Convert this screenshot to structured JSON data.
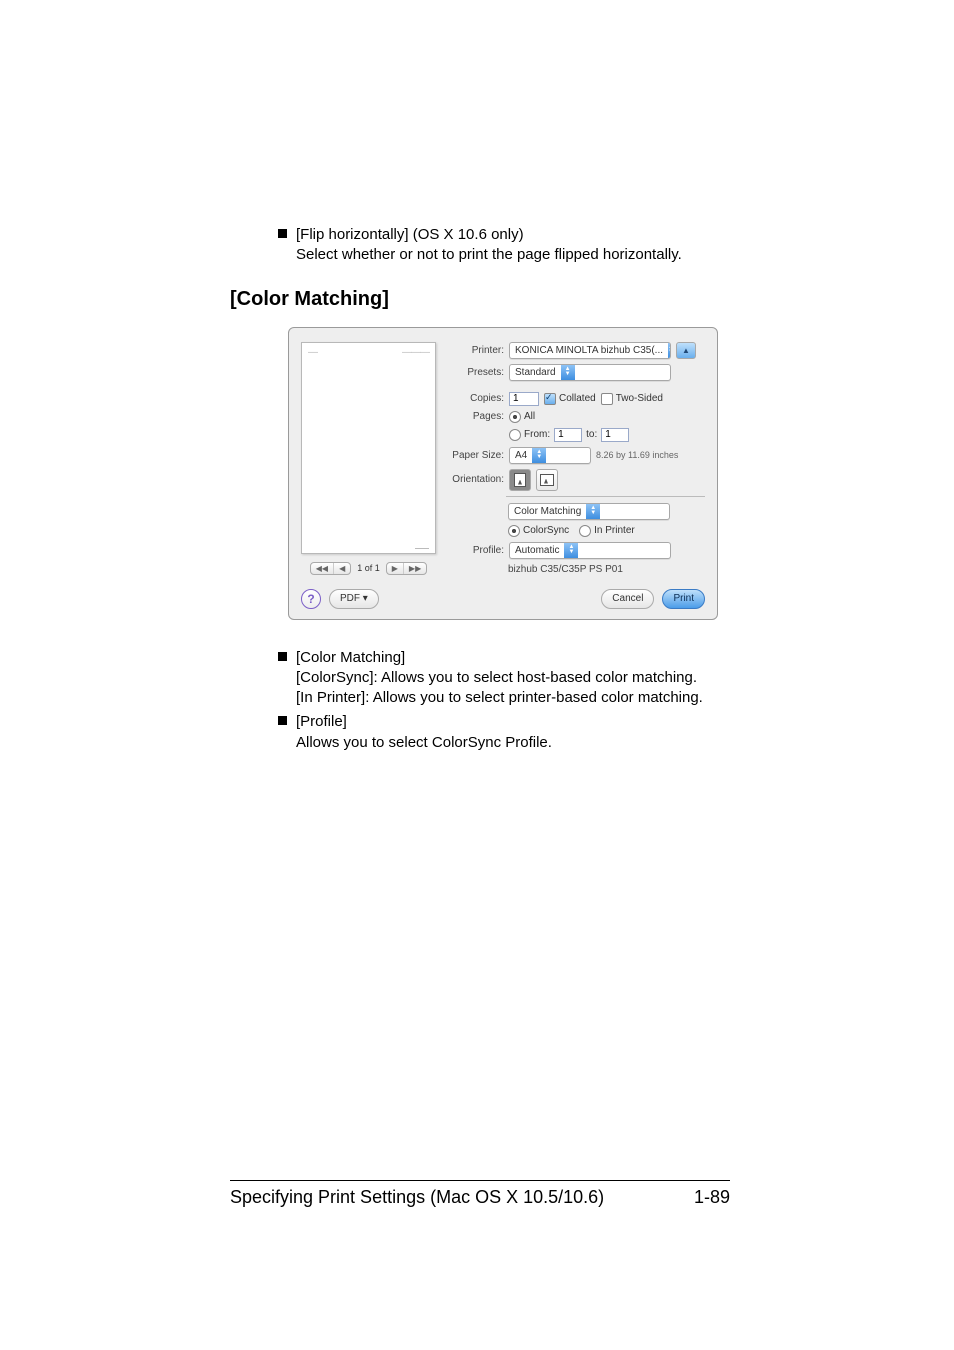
{
  "bullets_top": [
    {
      "head": "[Flip horizontally] (OS X 10.6 only)",
      "desc": "Select whether or not to print the page flipped horizontally."
    }
  ],
  "section_title": "[Color Matching]",
  "dialog": {
    "preview_nav": {
      "page": "1 of 1"
    },
    "rows": {
      "printer_label": "Printer:",
      "printer_value": "KONICA MINOLTA bizhub C35(...",
      "presets_label": "Presets:",
      "presets_value": "Standard",
      "copies_label": "Copies:",
      "copies_value": "1",
      "collated_label": "Collated",
      "twosided_label": "Two-Sided",
      "pages_label": "Pages:",
      "pages_all": "All",
      "pages_from": "From:",
      "pages_from_val": "1",
      "pages_to": "to:",
      "pages_to_val": "1",
      "papersize_label": "Paper Size:",
      "papersize_value": "A4",
      "papersize_dim": "8.26 by 11.69 inches",
      "orientation_label": "Orientation:"
    },
    "pane_value": "Color Matching",
    "colorsync_label": "ColorSync",
    "inprinter_label": "In Printer",
    "profile_label": "Profile:",
    "profile_value": "Automatic",
    "status": "bizhub C35/C35P PS P01",
    "pdf_label": "PDF ▾",
    "cancel_label": "Cancel",
    "print_label": "Print"
  },
  "bullets_bottom": [
    {
      "head": "[Color Matching]",
      "desc1": "[ColorSync]: Allows you to select host-based color matching.",
      "desc2": "[In Printer]: Allows you to select printer-based color matching."
    },
    {
      "head": "[Profile]",
      "desc1": "Allows you to select ColorSync Profile."
    }
  ],
  "footer": {
    "left": "Specifying Print Settings (Mac OS X 10.5/10.6)",
    "right": "1-89"
  }
}
